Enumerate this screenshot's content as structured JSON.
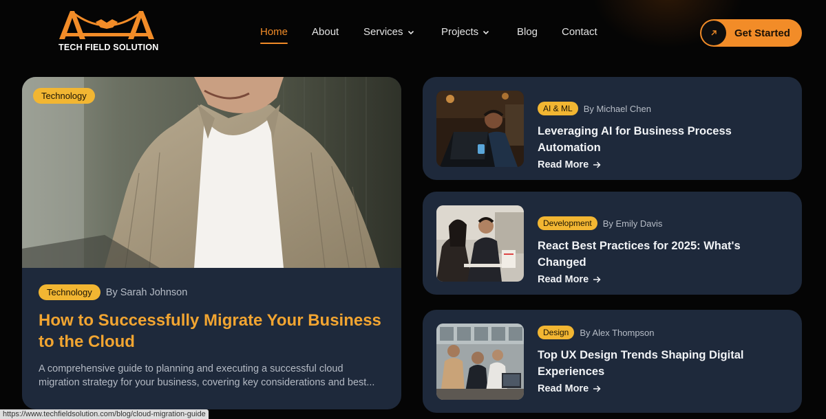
{
  "brand": {
    "name": "TECH FIELD SOLUTION",
    "accent": "#f28c28",
    "badge_color": "#f2b632"
  },
  "nav": {
    "items": [
      {
        "label": "Home",
        "active": true
      },
      {
        "label": "About"
      },
      {
        "label": "Services",
        "dropdown": true
      },
      {
        "label": "Projects",
        "dropdown": true
      },
      {
        "label": "Blog"
      },
      {
        "label": "Contact"
      }
    ],
    "cta": {
      "label": "Get Started",
      "icon": "arrow-up-right-icon"
    }
  },
  "featured": {
    "image_badge": "Technology",
    "badge": "Technology",
    "author": "By Sarah Johnson",
    "title": "How to Successfully Migrate Your Business to the Cloud",
    "description": "A comprehensive guide to planning and executing a successful cloud migration strategy for your business, covering key considerations and best..."
  },
  "posts": [
    {
      "badge": "AI & ML",
      "author": "By Michael Chen",
      "title": "Leveraging AI for Business Process Automation",
      "read_more": "Read More"
    },
    {
      "badge": "Development",
      "author": "By Emily Davis",
      "title": "React Best Practices for 2025: What's Changed",
      "read_more": "Read More"
    },
    {
      "badge": "Design",
      "author": "By Alex Thompson",
      "title": "Top UX Design Trends Shaping Digital Experiences",
      "read_more": "Read More"
    }
  ],
  "status_bar": {
    "url": "https://www.techfieldsolution.com/blog/cloud-migration-guide"
  }
}
